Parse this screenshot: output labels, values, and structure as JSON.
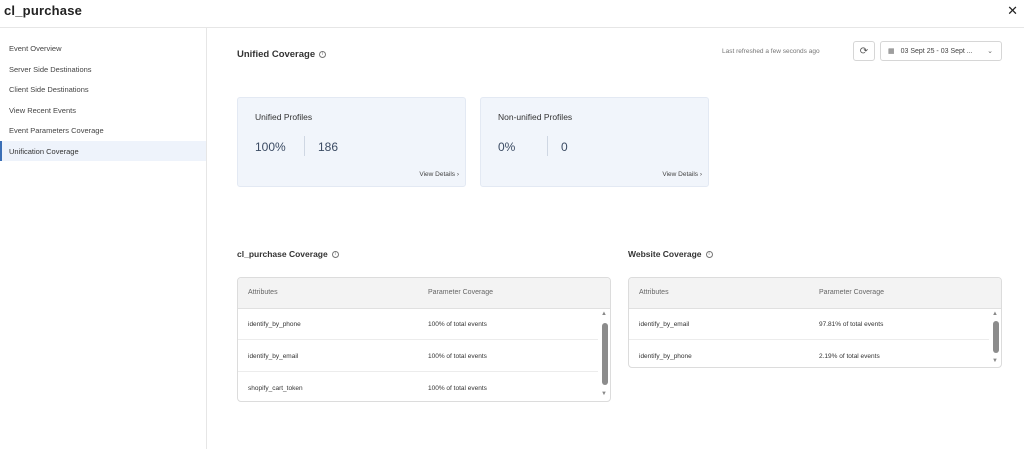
{
  "window": {
    "title": "cl_purchase",
    "close_label": "✕"
  },
  "sidebar": {
    "items": [
      {
        "label": "Event Overview"
      },
      {
        "label": "Server Side Destinations"
      },
      {
        "label": "Client Side Destinations"
      },
      {
        "label": "View Recent Events"
      },
      {
        "label": "Event Parameters Coverage"
      },
      {
        "label": "Unification Coverage",
        "active": true
      }
    ]
  },
  "header": {
    "title": "Unified Coverage",
    "refresh_text": "Last refreshed a few seconds ago",
    "date_range": "03 Sept 25 - 03 Sept ..."
  },
  "cards": [
    {
      "title": "Unified Profiles",
      "percent": "100%",
      "count": "186",
      "link": "View Details ›"
    },
    {
      "title": "Non-unified Profiles",
      "percent": "0%",
      "count": "0",
      "link": "View Details ›"
    }
  ],
  "event_coverage": {
    "title": "cl_purchase Coverage",
    "columns": [
      "Attributes",
      "Parameter Coverage"
    ],
    "rows": [
      [
        "identify_by_phone",
        "100% of total events"
      ],
      [
        "identify_by_email",
        "100% of total events"
      ],
      [
        "shopify_cart_token",
        "100% of total events"
      ]
    ]
  },
  "website_coverage": {
    "title": "Website Coverage",
    "columns": [
      "Attributes",
      "Parameter Coverage"
    ],
    "rows": [
      [
        "identify_by_email",
        "97.81% of total events"
      ],
      [
        "identify_by_phone",
        "2.19% of total events"
      ]
    ]
  },
  "icons": {
    "info": "info-icon",
    "refresh": "refresh-icon",
    "calendar": "calendar-icon",
    "chevron": "chevron-down-icon"
  },
  "colors": {
    "accent": "#3b6fb6",
    "card_bg": "#f1f5fb",
    "active_item_bg": "#eef3fb"
  }
}
